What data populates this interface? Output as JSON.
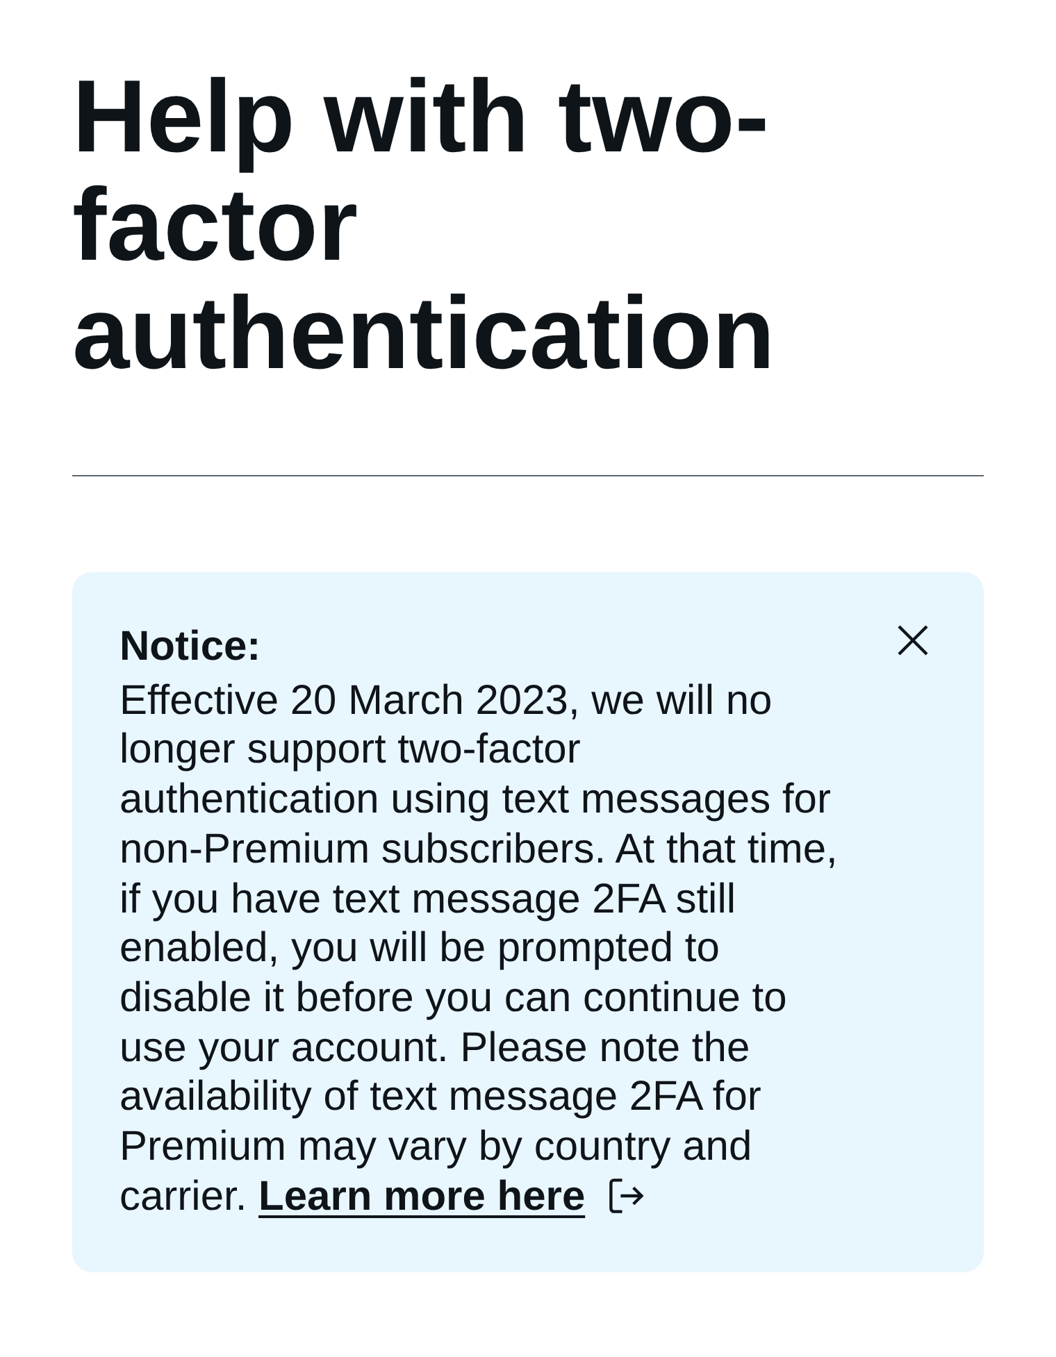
{
  "heading": "Help with two-factor authentication",
  "notice": {
    "title": "Notice:",
    "body": "Effective 20 March 2023, we will no longer support two-factor authentication using text messages for non-Premium subscribers. At that time, if you have text message 2FA still enabled, you will be prompted to disable it before you can continue to use your account. Please note the availability of text message 2FA for Premium may vary by country and carrier.",
    "link": "Learn more here",
    "dismissible": true
  }
}
